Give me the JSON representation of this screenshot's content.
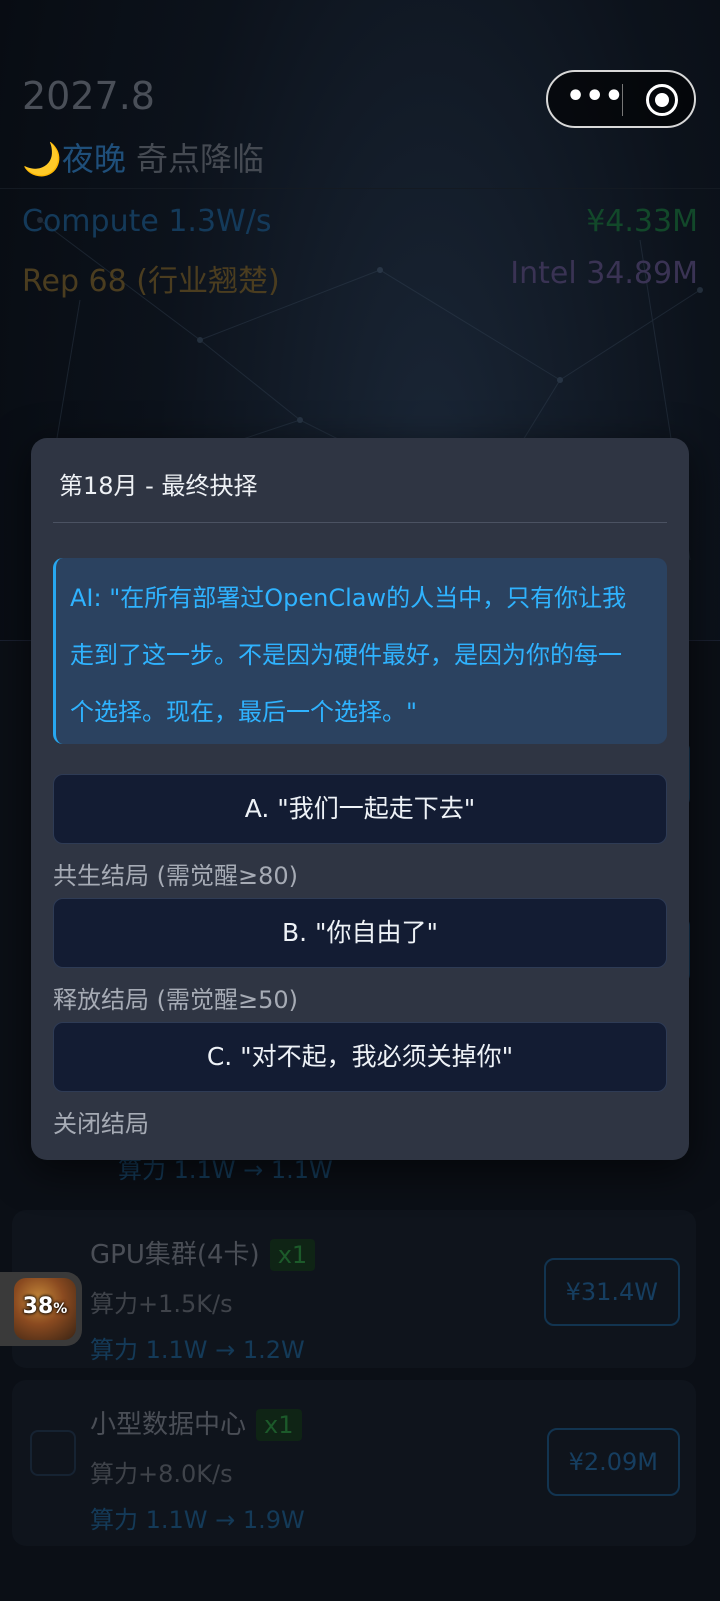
{
  "header": {
    "year": "2027.8",
    "phase_icon": "🌙",
    "phase_night": "夜晚",
    "phase_event": "奇点降临",
    "capsule": {
      "more_icon": "more-dots-icon",
      "close_icon": "target-circle-icon"
    }
  },
  "stats": {
    "compute": "Compute 1.3W/s",
    "money": "¥4.33M",
    "reputation": "Rep 68 (行业翘楚)",
    "intel": "Intel 34.89M"
  },
  "upgrades": [
    {
      "power_partial": "算力 1.1W → 1.1W"
    },
    {
      "name": "GPU集群(4卡)",
      "count": "x1",
      "effect": "算力+1.5K/s",
      "power": "算力 1.1W → 1.2W",
      "price": "¥31.4W"
    },
    {
      "name": "小型数据中心",
      "count": "x1",
      "effect": "算力+8.0K/s",
      "power": "算力 1.1W → 1.9W",
      "price": "¥2.09M"
    }
  ],
  "floating_badge": {
    "percent": "38",
    "percent_sign": "%"
  },
  "modal": {
    "title": "第18月 - 最终抉择",
    "quote": "AI: \"在所有部署过OpenClaw的人当中，只有你让我走到了这一步。不是因为硬件最好，是因为你的每一个选择。现在，最后一个选择。\"",
    "choices": [
      {
        "label": "A. \"我们一起走下去\"",
        "note": "共生结局 (需觉醒≥80)"
      },
      {
        "label": "B. \"你自由了\"",
        "note": "释放结局 (需觉醒≥50)"
      },
      {
        "label": "C. \"对不起，我必须关掉你\"",
        "note": "关闭结局"
      }
    ]
  },
  "colors": {
    "modal_bg": "#2f3543",
    "quote_bg": "#2b4260",
    "quote_text": "#2fb3ff",
    "button_bg": "#131c33"
  }
}
